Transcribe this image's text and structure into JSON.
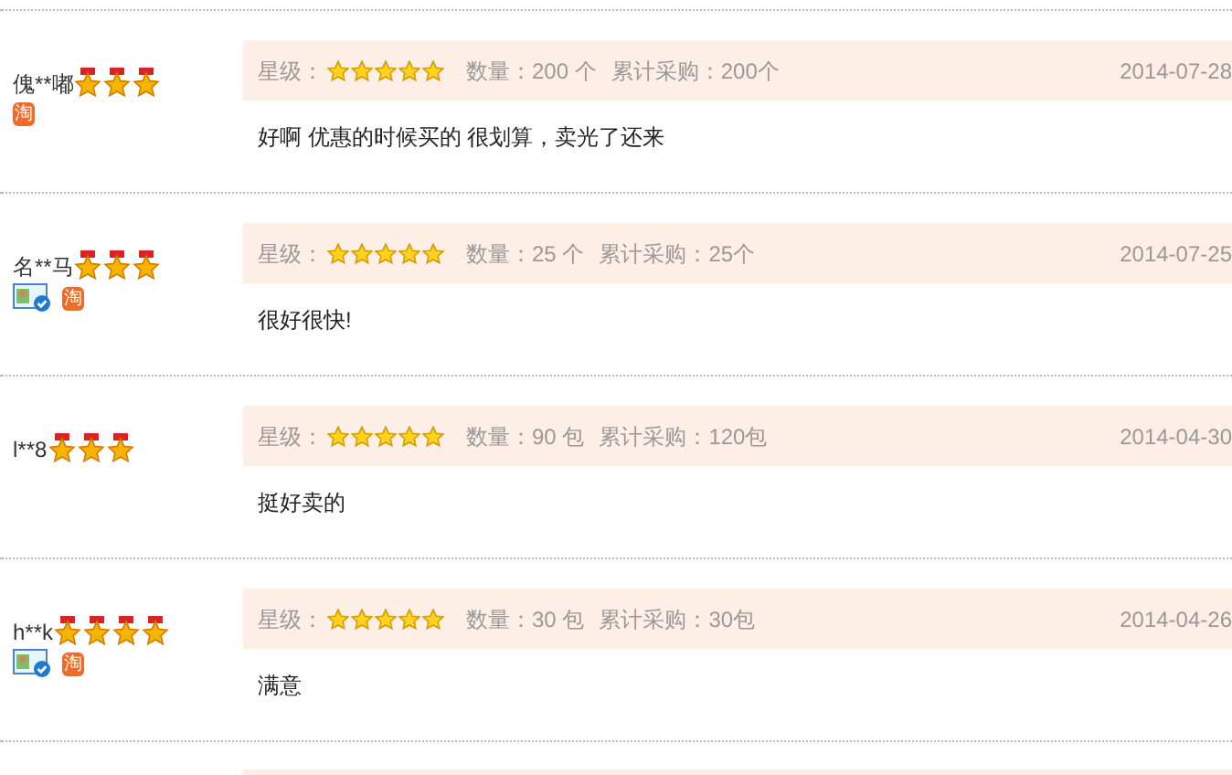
{
  "reviews": [
    {
      "buyer": {
        "name": "傀**嘟",
        "stars": 3,
        "verified": false,
        "shop_badge": "淘"
      },
      "rating_label": "星级：",
      "rating": {
        "stars": 5
      },
      "quantity": "数量：200 个",
      "total": "累计采购：200个",
      "date": "2014-07-28",
      "comment": "好啊 优惠的时候买的 很划算，卖光了还来"
    },
    {
      "buyer": {
        "name": "名**马",
        "stars": 3,
        "verified": true,
        "shop_badge": "淘"
      },
      "rating_label": "星级：",
      "rating": {
        "stars": 5
      },
      "quantity": "数量：25 个",
      "total": "累计采购：25个",
      "date": "2014-07-25",
      "comment": "很好很快!"
    },
    {
      "buyer": {
        "name": "l**8",
        "stars": 3,
        "verified": false
      },
      "rating_label": "星级：",
      "rating": {
        "stars": 5
      },
      "quantity": "数量：90 包",
      "total": "累计采购：120包",
      "date": "2014-04-30",
      "comment": "挺好卖的"
    },
    {
      "buyer": {
        "name": "h**k",
        "stars": 4,
        "verified": true,
        "shop_badge": "淘"
      },
      "rating_label": "星级：",
      "rating": {
        "stars": 5
      },
      "quantity": "数量：30 包",
      "total": "累计采购：30包",
      "date": "2014-04-26",
      "comment": "满意"
    }
  ],
  "next_review_partial": true
}
